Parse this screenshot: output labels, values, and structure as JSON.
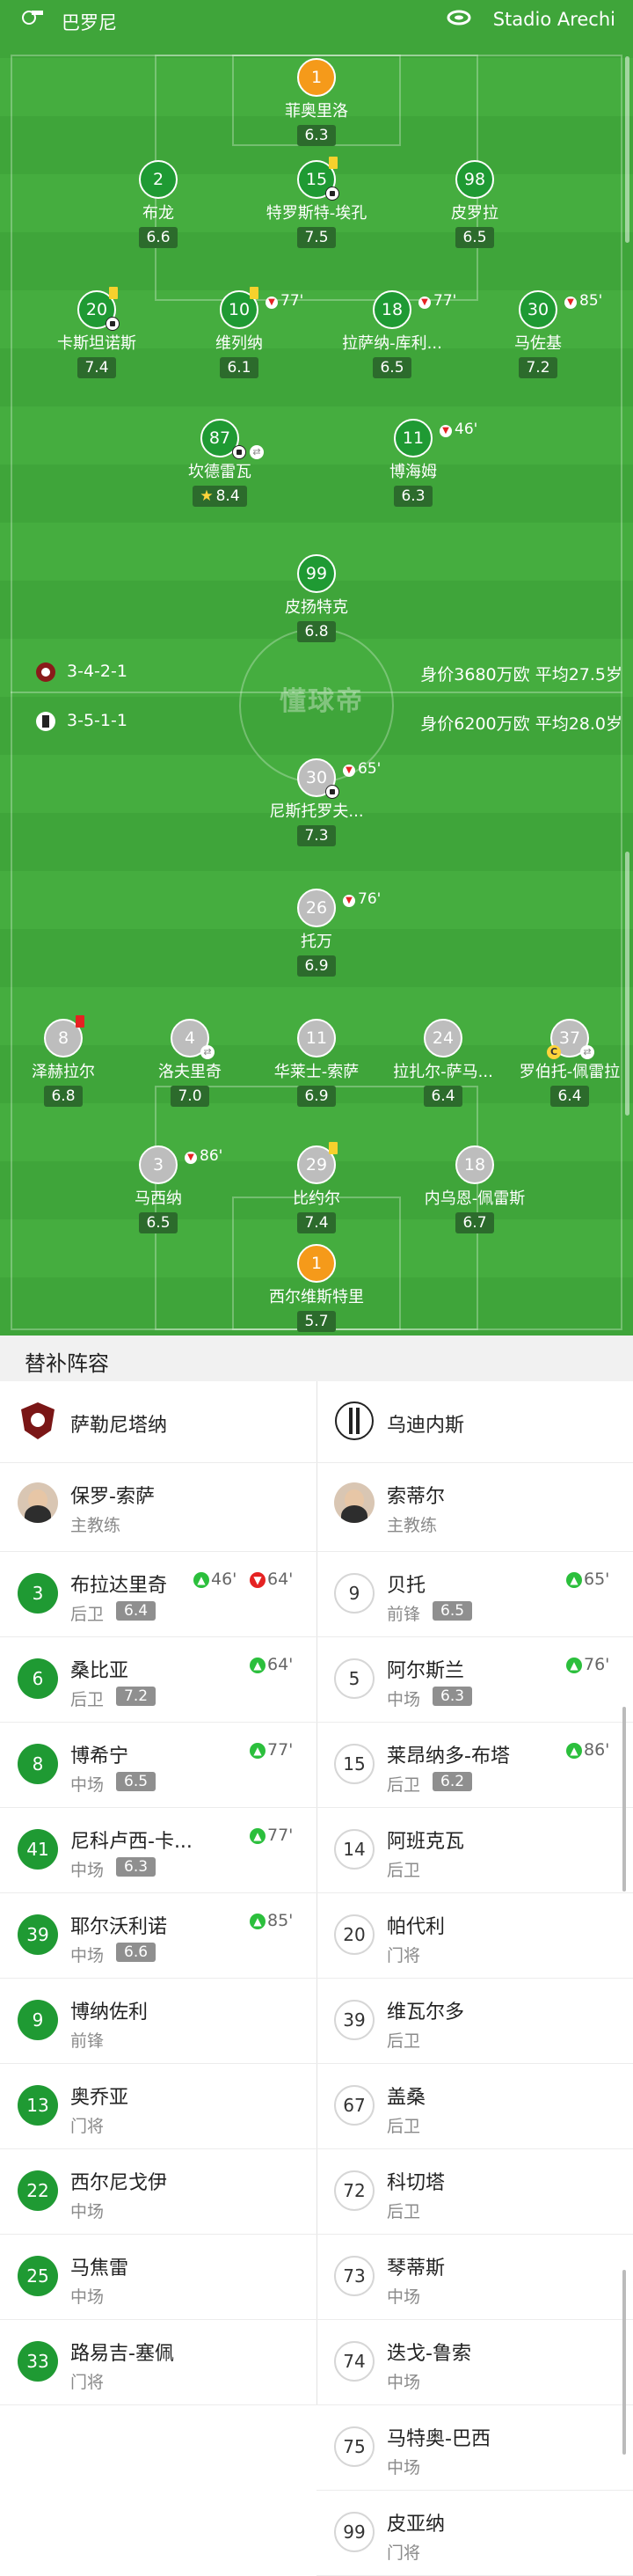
{
  "header": {
    "referee": "巴罗尼",
    "stadium": "Stadio Arechi"
  },
  "home_team": {
    "formation": "3-4-2-1",
    "value": "身价3680万欧 平均27.5岁"
  },
  "away_team": {
    "formation": "3-5-1-1",
    "value": "身价6200万欧 平均28.0岁"
  },
  "watermark": "懂球帝",
  "home_players": [
    {
      "num": "1",
      "name": "菲奥里洛",
      "rating": "6.3"
    },
    {
      "num": "2",
      "name": "布龙",
      "rating": "6.6"
    },
    {
      "num": "15",
      "name": "特罗斯特-埃孔",
      "rating": "7.5"
    },
    {
      "num": "98",
      "name": "皮罗拉",
      "rating": "6.5"
    },
    {
      "num": "20",
      "name": "卡斯坦诺斯",
      "rating": "7.4"
    },
    {
      "num": "10",
      "name": "维列纳",
      "rating": "6.1",
      "sub": "77'"
    },
    {
      "num": "18",
      "name": "拉萨纳-库利...",
      "rating": "6.5",
      "sub": "77'"
    },
    {
      "num": "30",
      "name": "马佐基",
      "rating": "7.2",
      "sub": "85'"
    },
    {
      "num": "87",
      "name": "坎德雷瓦",
      "rating": "8.4"
    },
    {
      "num": "11",
      "name": "博海姆",
      "rating": "6.3",
      "sub": "46'"
    },
    {
      "num": "99",
      "name": "皮扬特克",
      "rating": "6.8"
    }
  ],
  "away_players": [
    {
      "num": "30",
      "name": "尼斯托罗夫...",
      "rating": "7.3",
      "sub": "65'"
    },
    {
      "num": "26",
      "name": "托万",
      "rating": "6.9",
      "sub": "76'"
    },
    {
      "num": "8",
      "name": "泽赫拉尔",
      "rating": "6.8"
    },
    {
      "num": "4",
      "name": "洛夫里奇",
      "rating": "7.0"
    },
    {
      "num": "11",
      "name": "华莱士-索萨",
      "rating": "6.9"
    },
    {
      "num": "24",
      "name": "拉扎尔-萨马...",
      "rating": "6.4"
    },
    {
      "num": "37",
      "name": "罗伯托-佩雷拉",
      "rating": "6.4"
    },
    {
      "num": "3",
      "name": "马西纳",
      "rating": "6.5",
      "sub": "86'"
    },
    {
      "num": "29",
      "name": "比约尔",
      "rating": "7.4"
    },
    {
      "num": "18",
      "name": "内乌恩-佩雷斯",
      "rating": "6.7"
    },
    {
      "num": "1",
      "name": "西尔维斯特里",
      "rating": "5.7"
    }
  ],
  "subs": {
    "title": "替补阵容",
    "home": {
      "team": "萨勒尼塔纳",
      "coach": {
        "name": "保罗-索萨",
        "role": "主教练"
      },
      "list": [
        {
          "num": "3",
          "name": "布拉达里奇",
          "pos": "后卫",
          "rating": "6.4",
          "in": "46'",
          "out": "64'"
        },
        {
          "num": "6",
          "name": "桑比亚",
          "pos": "后卫",
          "rating": "7.2",
          "in": "64'"
        },
        {
          "num": "8",
          "name": "博希宁",
          "pos": "中场",
          "rating": "6.5",
          "in": "77'"
        },
        {
          "num": "41",
          "name": "尼科卢西-卡...",
          "pos": "中场",
          "rating": "6.3",
          "in": "77'"
        },
        {
          "num": "39",
          "name": "耶尔沃利诺",
          "pos": "中场",
          "rating": "6.6",
          "in": "85'"
        },
        {
          "num": "9",
          "name": "博纳佐利",
          "pos": "前锋"
        },
        {
          "num": "13",
          "name": "奥乔亚",
          "pos": "门将"
        },
        {
          "num": "22",
          "name": "西尔尼戈伊",
          "pos": "中场"
        },
        {
          "num": "25",
          "name": "马焦雷",
          "pos": "中场"
        },
        {
          "num": "33",
          "name": "路易吉-塞佩",
          "pos": "门将"
        }
      ]
    },
    "away": {
      "team": "乌迪内斯",
      "coach": {
        "name": "索蒂尔",
        "role": "主教练"
      },
      "list": [
        {
          "num": "9",
          "name": "贝托",
          "pos": "前锋",
          "rating": "6.5",
          "in": "65'"
        },
        {
          "num": "5",
          "name": "阿尔斯兰",
          "pos": "中场",
          "rating": "6.3",
          "in": "76'"
        },
        {
          "num": "15",
          "name": "莱昂纳多-布塔",
          "pos": "后卫",
          "rating": "6.2",
          "in": "86'"
        },
        {
          "num": "14",
          "name": "阿班克瓦",
          "pos": "后卫"
        },
        {
          "num": "20",
          "name": "帕代利",
          "pos": "门将"
        },
        {
          "num": "39",
          "name": "维瓦尔多",
          "pos": "后卫"
        },
        {
          "num": "67",
          "name": "盖桑",
          "pos": "后卫"
        },
        {
          "num": "72",
          "name": "科切塔",
          "pos": "后卫"
        },
        {
          "num": "73",
          "name": "琴蒂斯",
          "pos": "中场"
        },
        {
          "num": "74",
          "name": "迭戈-鲁索",
          "pos": "中场"
        },
        {
          "num": "75",
          "name": "马特奥-巴西",
          "pos": "中场"
        },
        {
          "num": "99",
          "name": "皮亚纳",
          "pos": "门将"
        }
      ]
    }
  },
  "colors": {
    "pitch": "#3fa53a",
    "home": "#1f9a33",
    "away": "#bdbdbd",
    "gk": "#f59a1a",
    "sub_in": "#2bbf3c",
    "sub_out": "#e52222"
  }
}
